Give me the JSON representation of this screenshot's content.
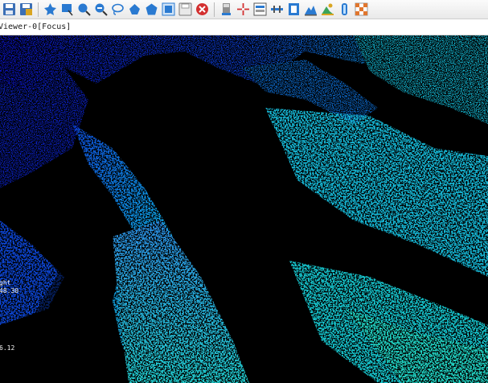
{
  "toolbar": {
    "buttons": [
      {
        "name": "save-icon",
        "color": "#3b6fb6"
      },
      {
        "name": "save-as-icon",
        "color": "#d9a521"
      },
      {
        "name": "select-pin-icon",
        "color": "#2a7ad1"
      },
      {
        "name": "select-rectangle-icon",
        "color": "#2a7ad1"
      },
      {
        "name": "zoom-in-icon",
        "color": "#2a7ad1"
      },
      {
        "name": "zoom-out-icon",
        "color": "#2a7ad1"
      },
      {
        "name": "lasso-icon",
        "color": "#2a7ad1"
      },
      {
        "name": "select-polygon-icon",
        "color": "#2a7ad1"
      },
      {
        "name": "select-pentagon-icon",
        "color": "#2a7ad1"
      },
      {
        "name": "select-box-icon",
        "color": "#2a7ad1"
      },
      {
        "name": "save-selection-icon",
        "color": "#4a4a4a"
      },
      {
        "name": "cancel-icon",
        "color": "#d32f2f"
      },
      {
        "name": "measure-icon",
        "color": "#555555"
      },
      {
        "name": "crosshair-icon",
        "color": "#d32f2f"
      },
      {
        "name": "profile-icon",
        "color": "#2a7ad1"
      },
      {
        "name": "section-icon",
        "color": "#2a7ad1"
      },
      {
        "name": "frame-icon",
        "color": "#2a7ad1"
      },
      {
        "name": "terrain-icon",
        "color": "#2a7ad1"
      },
      {
        "name": "landscape-icon",
        "color": "#d9a521"
      },
      {
        "name": "color-bar-icon",
        "color": "#2a7ad1"
      },
      {
        "name": "checker-icon",
        "color": "#e0762e"
      }
    ]
  },
  "viewer": {
    "tab_label": "Viewer-0[Focus]",
    "overlay": {
      "line1": "ght",
      "line2": "48.30",
      "line3": "6.12"
    }
  }
}
